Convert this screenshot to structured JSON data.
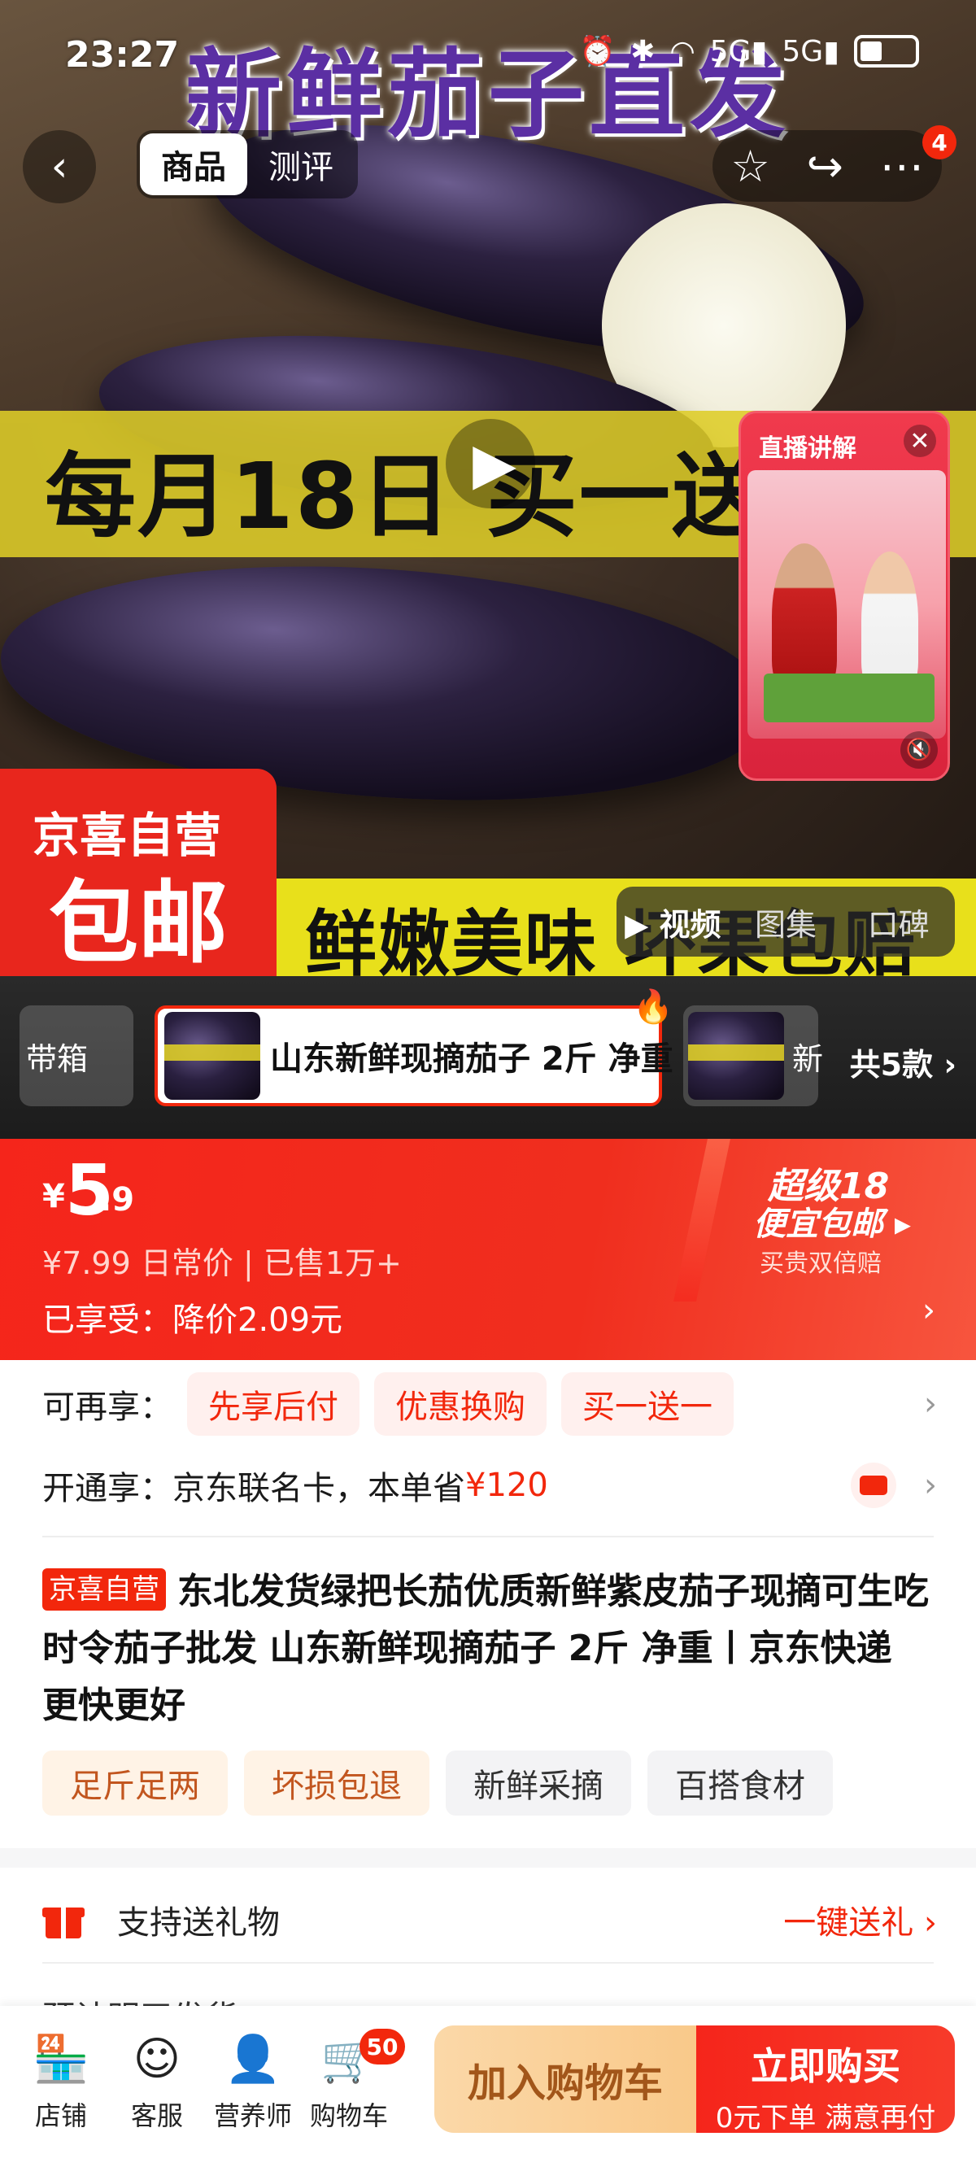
{
  "status_bar": {
    "time": "23:27",
    "network_1": "5G",
    "network_2": "5G"
  },
  "hero": {
    "headline": "新鲜茄子直发",
    "banner_text": "每月18日 买一送",
    "badge_small": "京喜自营",
    "badge_big": "包邮",
    "banner_bottom": "鲜嫩美味 坏果包赔",
    "media_tabs": [
      "视频",
      "图集",
      "口碑"
    ]
  },
  "nav": {
    "tabs": [
      "商品",
      "测评"
    ],
    "notif_count": "4",
    "icons": [
      "back-icon",
      "star-icon",
      "share-icon",
      "more-icon"
    ]
  },
  "live": {
    "title": "直播讲解"
  },
  "variants": {
    "left_label": "带箱",
    "active_label": "山东新鲜现摘茄子 2斤 净重",
    "right_label": "新",
    "total": "共5款"
  },
  "price": {
    "yen": "¥",
    "int": "5",
    "dec": ".9",
    "original": "¥7.99 日常价 | 已售1万+",
    "saved": "已享受：降价2.09元",
    "promo_line1": "超级18",
    "promo_line2": "便宜包邮",
    "promo_line3": "买贵双倍赔"
  },
  "benefits": {
    "label": "可再享：",
    "chips": [
      "先享后付",
      "优惠换购",
      "买一送一"
    ]
  },
  "card": {
    "label": "开通享：京东联名卡，本单省",
    "amount": "¥120"
  },
  "product": {
    "tag": "京喜自营",
    "title": "东北发货绿把长茄优质新鲜紫皮茄子现摘可生吃时令茄子批发 山东新鲜现摘茄子 2斤 净重丨京东快递 更快更好",
    "tags": [
      {
        "label": "足斤足两",
        "style": "warm"
      },
      {
        "label": "坏损包退",
        "style": "warm"
      },
      {
        "label": "新鲜采摘",
        "style": "gray"
      },
      {
        "label": "百搭食材",
        "style": "gray"
      }
    ]
  },
  "gift": {
    "label": "支持送礼物",
    "action": "一键送礼"
  },
  "peek_row": "预计明天发货",
  "bottom": {
    "items": [
      "店铺",
      "客服",
      "营养师",
      "购物车"
    ],
    "cart_count": "50",
    "add_cart": "加入购物车",
    "buy_now": "立即购买",
    "buy_sub": "0元下单 满意再付"
  },
  "colors": {
    "accent": "#f2270c",
    "headline_purple": "#5b2fa3",
    "band_yellow": "#dedc28"
  }
}
